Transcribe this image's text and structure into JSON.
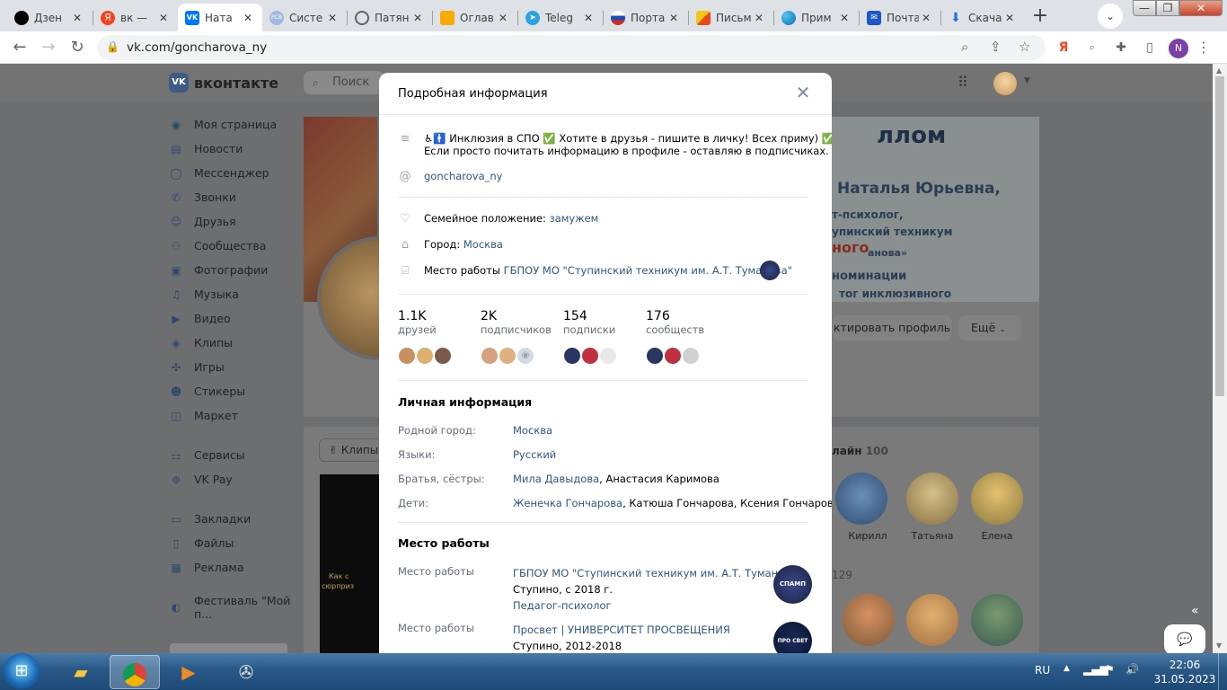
{
  "browser": {
    "tabs": [
      {
        "label": "Дзен",
        "icon": "dzen-icon",
        "color": "#000000"
      },
      {
        "label": "вк —",
        "icon": "yandex-icon",
        "color": "#fc3f1d"
      },
      {
        "label": "Ната",
        "icon": "vk-icon",
        "color": "#0077ff"
      },
      {
        "label": "Систе",
        "icon": "pcb-icon",
        "color": "#9fbadf"
      },
      {
        "label": "Патян",
        "icon": "globe-icon",
        "color": "#5f6368"
      },
      {
        "label": "Оглав",
        "icon": "slides-icon",
        "color": "#f9ab00"
      },
      {
        "label": "Teleg",
        "icon": "telegram-icon",
        "color": "#2aa3df"
      },
      {
        "label": "Порта",
        "icon": "russia-flag-icon",
        "color": "#d52b1e"
      },
      {
        "label": "Письм",
        "icon": "mail-icon",
        "color": "#f5c518"
      },
      {
        "label": "Прим",
        "icon": "edge-icon",
        "color": "#0b6fb7"
      },
      {
        "label": "Почта",
        "icon": "outlook-icon",
        "color": "#1e57c7"
      },
      {
        "label": "Скача",
        "icon": "download-icon",
        "color": "#1a73e8"
      }
    ],
    "url": "vk.com/goncharova_ny",
    "profile_initial": "N"
  },
  "vk": {
    "brand": "вконтакте",
    "search_placeholder": "Поиск",
    "menu": [
      {
        "label": "Моя страница",
        "icon": "user-icon"
      },
      {
        "label": "Новости",
        "icon": "news-icon"
      },
      {
        "label": "Мессенджер",
        "icon": "messenger-icon"
      },
      {
        "label": "Звонки",
        "icon": "phone-icon"
      },
      {
        "label": "Друзья",
        "icon": "friends-icon"
      },
      {
        "label": "Сообщества",
        "icon": "communities-icon"
      },
      {
        "label": "Фотографии",
        "icon": "photos-icon"
      },
      {
        "label": "Музыка",
        "icon": "music-icon"
      },
      {
        "label": "Видео",
        "icon": "video-icon"
      },
      {
        "label": "Клипы",
        "icon": "clips-icon"
      },
      {
        "label": "Игры",
        "icon": "games-icon"
      },
      {
        "label": "Стикеры",
        "icon": "stickers-icon"
      },
      {
        "label": "Маркет",
        "icon": "market-icon"
      }
    ],
    "menu2": [
      {
        "label": "Сервисы",
        "icon": "services-icon"
      },
      {
        "label": "VK Pay",
        "icon": "vkpay-icon"
      }
    ],
    "menu3": [
      {
        "label": "Закладки",
        "icon": "bookmark-icon"
      },
      {
        "label": "Файлы",
        "icon": "files-icon"
      },
      {
        "label": "Реклама",
        "icon": "ads-icon"
      }
    ],
    "menu4": [
      {
        "label": "Фестиваль \"Мой п...",
        "icon": "festival-icon"
      }
    ],
    "edit_profile": "ктировать профиль",
    "more": "Ещё",
    "clips_tab": "Клипы",
    "clip_text_1": "Как с",
    "clip_text_2": "сюрприз",
    "online_label": "лайн",
    "online_count": "100",
    "friends_online": [
      "Кирилл",
      "Татьяна",
      "Елена"
    ],
    "friends_count_partial": "129",
    "banner_lines": [
      "ллом",
      "Наталья Юрьевна,",
      "т-психолог,",
      "упинский техникум",
      "ного",
      "ановa»",
      "номинации",
      "тог инклюзивного"
    ]
  },
  "modal": {
    "title": "Подробная информация",
    "status_line1": "♿🚹 Инклюзия в СПО ✅ Хотите в друзья - пишите в личку! Всех приму) ✅",
    "status_line2": "Если просто почитать информацию в профиле - оставляю в подписчиках.",
    "nickname": "goncharova_ny",
    "marital_label": "Семейное положение:",
    "marital_value": "замужем",
    "city_label": "Город:",
    "city_value": "Москва",
    "work_label": "Место работы",
    "work_value": "ГБПОУ МО \"Ступинский техникум им. А.Т. Туманова\"",
    "stats": [
      {
        "num": "1.1K",
        "label": "друзей"
      },
      {
        "num": "2K",
        "label": "подписчиков"
      },
      {
        "num": "154",
        "label": "подписки"
      },
      {
        "num": "176",
        "label": "сообществ"
      }
    ],
    "personal_title": "Личная информация",
    "personal": [
      {
        "label": "Родной город:",
        "link": "Москва",
        "rest": ""
      },
      {
        "label": "Языки:",
        "link": "Русский",
        "rest": ""
      },
      {
        "label": "Братья, сёстры:",
        "link": "Мила Давыдова",
        "rest": ", Анастасия Каримова"
      },
      {
        "label": "Дети:",
        "link": "Женечка Гончарова",
        "rest": ", Катюша Гончарова, Ксения Гончарова"
      }
    ],
    "work_title": "Место работы",
    "jobs": [
      {
        "label": "Место работы",
        "org": "ГБПОУ МО \"Ступинский техникум им. А.Т. Туманова\"",
        "period": "Ступино, с 2018 г.",
        "position": "Педагог-психолог",
        "logo": "СПАМП"
      },
      {
        "label": "Место работы",
        "org": "Просвет | УНИВЕРСИТЕТ ПРОСВЕЩЕНИЯ",
        "period": "Ступино, 2012-2018",
        "position": "",
        "logo": "ПРО СВЕТ"
      }
    ]
  },
  "taskbar": {
    "lang": "RU",
    "time": "22:06",
    "date": "31.05.2023"
  }
}
